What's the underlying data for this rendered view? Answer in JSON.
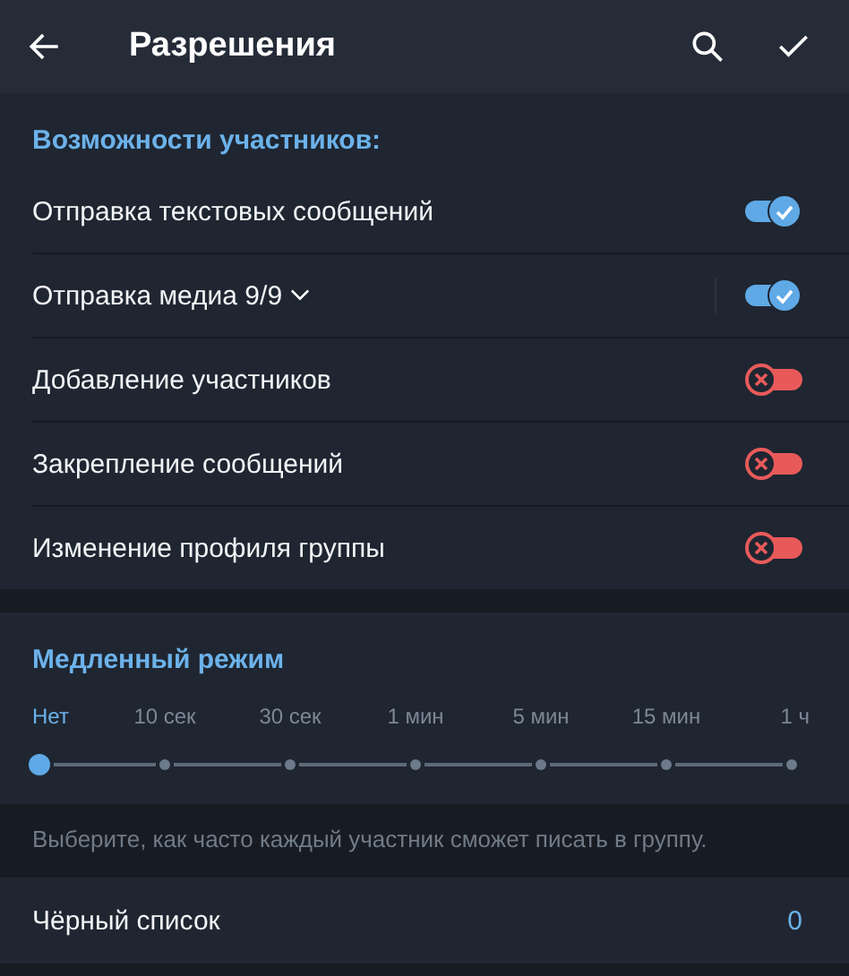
{
  "header": {
    "title": "Разрешения"
  },
  "permissions": {
    "title": "Возможности участников:",
    "items": [
      {
        "kind": "toggle",
        "label": "Отправка текстовых сообщений",
        "on": true
      },
      {
        "kind": "expandable",
        "label": "Отправка медиа 9/9",
        "on": true,
        "expanded": false
      },
      {
        "kind": "toggle",
        "label": "Добавление участников",
        "on": false
      },
      {
        "kind": "toggle",
        "label": "Закрепление сообщений",
        "on": false
      },
      {
        "kind": "toggle",
        "label": "Изменение профиля группы",
        "on": false
      }
    ]
  },
  "slow_mode": {
    "title": "Медленный режим",
    "options": [
      {
        "label": "Нет",
        "selected": true
      },
      {
        "label": "10 сек",
        "selected": false
      },
      {
        "label": "30 сек",
        "selected": false
      },
      {
        "label": "1 мин",
        "selected": false
      },
      {
        "label": "5 мин",
        "selected": false
      },
      {
        "label": "15 мин",
        "selected": false
      },
      {
        "label": "1 ч",
        "selected": false
      }
    ],
    "hint": "Выберите, как часто каждый участник сможет писать в группу."
  },
  "blacklist": {
    "label": "Чёрный список",
    "count": "0"
  }
}
